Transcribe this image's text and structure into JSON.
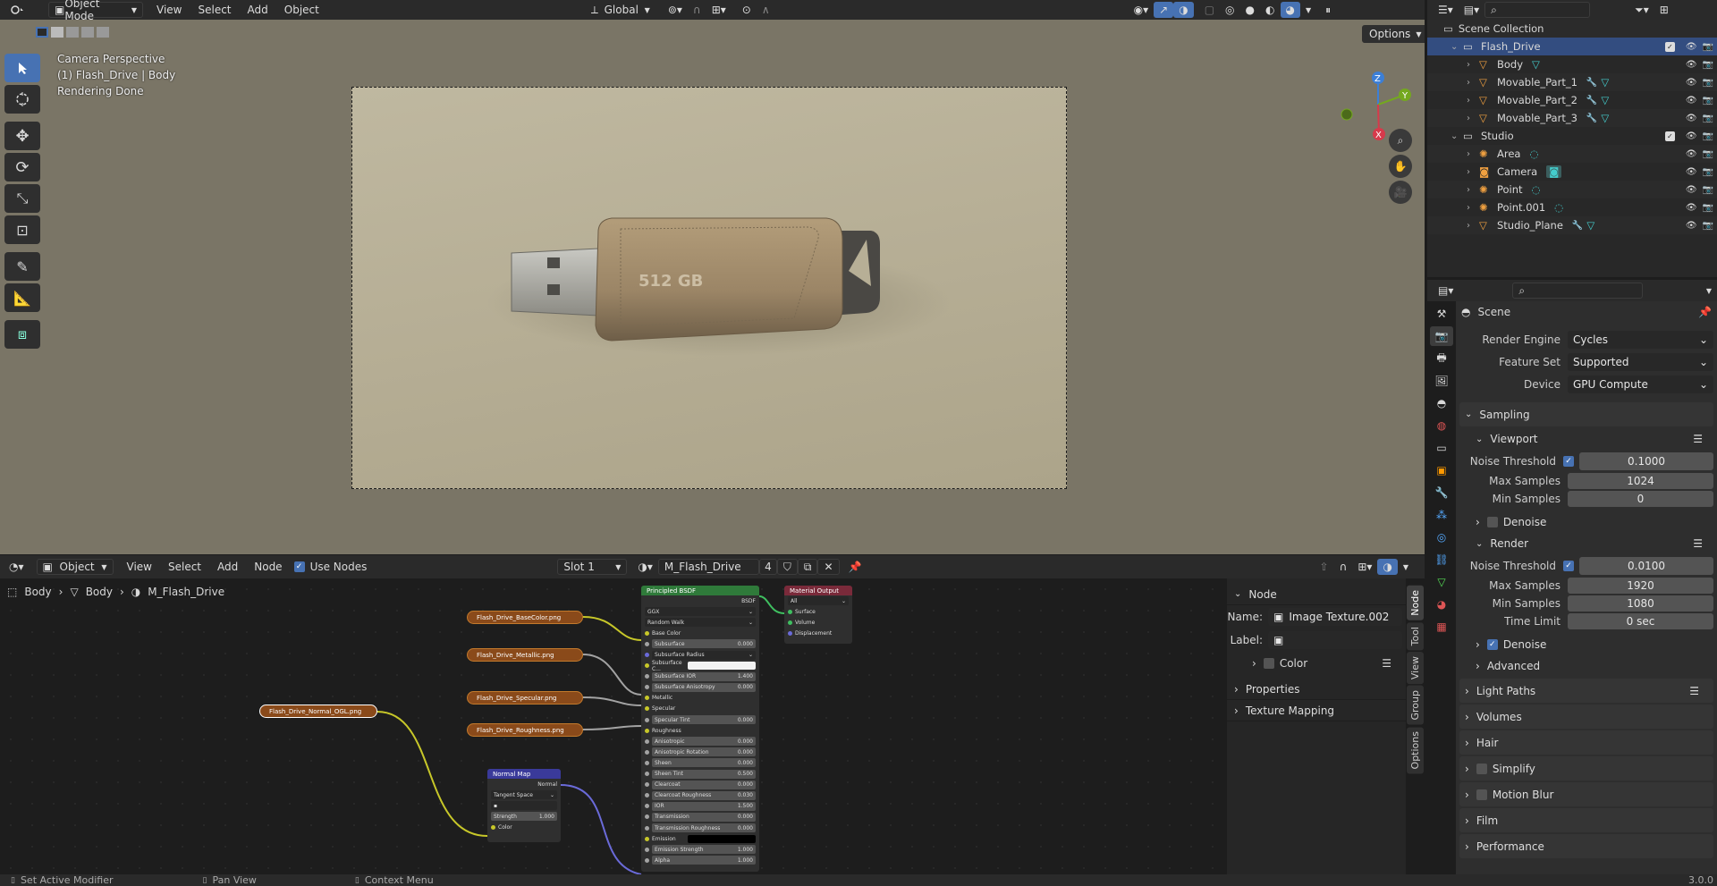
{
  "top_header": {
    "mode": "Object Mode",
    "menus": [
      "View",
      "Select",
      "Add",
      "Object"
    ],
    "orientation": "Global"
  },
  "viewport": {
    "info_lines": [
      "Camera Perspective",
      "(1) Flash_Drive | Body",
      "Rendering Done"
    ],
    "options_label": "Options",
    "flash_label": "512 GB",
    "gizmo_axes": {
      "z": "Z",
      "y": "Y",
      "x": "X"
    }
  },
  "node_header": {
    "type": "Object",
    "menus": [
      "View",
      "Select",
      "Add",
      "Node"
    ],
    "use_nodes_label": "Use Nodes",
    "use_nodes": true,
    "slot": "Slot 1",
    "material": "M_Flash_Drive",
    "users": "4"
  },
  "breadcrumb": [
    "Body",
    "Body",
    "M_Flash_Drive"
  ],
  "nodes": {
    "textures": [
      "Flash_Drive_BaseColor.png",
      "Flash_Drive_Metallic.png",
      "Flash_Drive_Specular.png",
      "Flash_Drive_Roughness.png",
      "Flash_Drive_Normal_OGL.png"
    ],
    "bsdf": {
      "title": "Principled BSDF",
      "output": "BSDF",
      "distribution": "GGX",
      "subsurface_method": "Random Walk",
      "rows": [
        {
          "label": "Base Color",
          "kind": "socket"
        },
        {
          "label": "Subsurface",
          "kind": "field",
          "value": "0.000"
        },
        {
          "label": "Subsurface Radius",
          "kind": "drop"
        },
        {
          "label": "Subsurface C...",
          "kind": "color"
        },
        {
          "label": "Subsurface IOR",
          "kind": "field",
          "value": "1.400"
        },
        {
          "label": "Subsurface Anisotropy",
          "kind": "field",
          "value": "0.000"
        },
        {
          "label": "Metallic",
          "kind": "socket"
        },
        {
          "label": "Specular",
          "kind": "socket"
        },
        {
          "label": "Specular Tint",
          "kind": "field",
          "value": "0.000"
        },
        {
          "label": "Roughness",
          "kind": "socket"
        },
        {
          "label": "Anisotropic",
          "kind": "field",
          "value": "0.000"
        },
        {
          "label": "Anisotropic Rotation",
          "kind": "field",
          "value": "0.000"
        },
        {
          "label": "Sheen",
          "kind": "field",
          "value": "0.000"
        },
        {
          "label": "Sheen Tint",
          "kind": "field",
          "value": "0.500"
        },
        {
          "label": "Clearcoat",
          "kind": "field",
          "value": "0.000"
        },
        {
          "label": "Clearcoat Roughness",
          "kind": "field",
          "value": "0.030"
        },
        {
          "label": "IOR",
          "kind": "field",
          "value": "1.500"
        },
        {
          "label": "Transmission",
          "kind": "field",
          "value": "0.000"
        },
        {
          "label": "Transmission Roughness",
          "kind": "field",
          "value": "0.000"
        },
        {
          "label": "Emission",
          "kind": "color"
        },
        {
          "label": "Emission Strength",
          "kind": "field",
          "value": "1.000"
        },
        {
          "label": "Alpha",
          "kind": "field",
          "value": "1.000"
        }
      ]
    },
    "material_output": {
      "title": "Material Output",
      "target": "All",
      "inputs": [
        "Surface",
        "Volume",
        "Displacement"
      ]
    },
    "normal_map": {
      "title": "Normal Map",
      "output": "Normal",
      "space": "Tangent Space",
      "strength_label": "Strength",
      "strength": "1.000",
      "color_label": "Color"
    }
  },
  "node_sidebar": {
    "section": "Node",
    "name_label": "Name:",
    "name_value": "Image Texture.002",
    "label_label": "Label:",
    "color_label": "Color",
    "properties_label": "Properties",
    "texture_mapping_label": "Texture Mapping",
    "tabs": [
      "Node",
      "Tool",
      "View",
      "Group",
      "Options"
    ]
  },
  "outliner": {
    "root": "Scene Collection",
    "rows": [
      {
        "name": "Flash_Drive",
        "type": "collection",
        "indent": 1
      },
      {
        "name": "Body",
        "type": "mesh",
        "indent": 2
      },
      {
        "name": "Movable_Part_1",
        "type": "mesh",
        "indent": 2
      },
      {
        "name": "Movable_Part_2",
        "type": "mesh",
        "indent": 2
      },
      {
        "name": "Movable_Part_3",
        "type": "mesh",
        "indent": 2
      },
      {
        "name": "Studio",
        "type": "collection",
        "indent": 1
      },
      {
        "name": "Area",
        "type": "light",
        "indent": 2
      },
      {
        "name": "Camera",
        "type": "camera",
        "indent": 2
      },
      {
        "name": "Point",
        "type": "light",
        "indent": 2
      },
      {
        "name": "Point.001",
        "type": "light",
        "indent": 2
      },
      {
        "name": "Studio_Plane",
        "type": "mesh",
        "indent": 2
      }
    ]
  },
  "properties": {
    "context": "Scene",
    "render_engine_label": "Render Engine",
    "render_engine": "Cycles",
    "feature_set_label": "Feature Set",
    "feature_set": "Supported",
    "device_label": "Device",
    "device": "GPU Compute",
    "sampling_label": "Sampling",
    "viewport_label": "Viewport",
    "noise_threshold_label": "Noise Threshold",
    "max_samples_label": "Max Samples",
    "min_samples_label": "Min Samples",
    "viewport_noise": "0.1000",
    "viewport_max": "1024",
    "viewport_min": "0",
    "denoise_label": "Denoise",
    "render_label": "Render",
    "render_noise": "0.0100",
    "render_max": "1920",
    "render_min": "1080",
    "time_limit_label": "Time Limit",
    "time_limit": "0 sec",
    "advanced_label": "Advanced",
    "panels": [
      "Light Paths",
      "Volumes",
      "Hair",
      "Simplify",
      "Motion Blur",
      "Film",
      "Performance"
    ]
  },
  "status_bar": {
    "items": [
      "Set Active Modifier",
      "Pan View",
      "Context Menu"
    ],
    "version": "3.0.0"
  },
  "colors": {
    "accent": "#4772b3",
    "selected_row": "#334d80",
    "bsdf_header": "#2f7a3a",
    "texture_node": "#8a4a1a",
    "link_yellow": "#c7c729"
  }
}
